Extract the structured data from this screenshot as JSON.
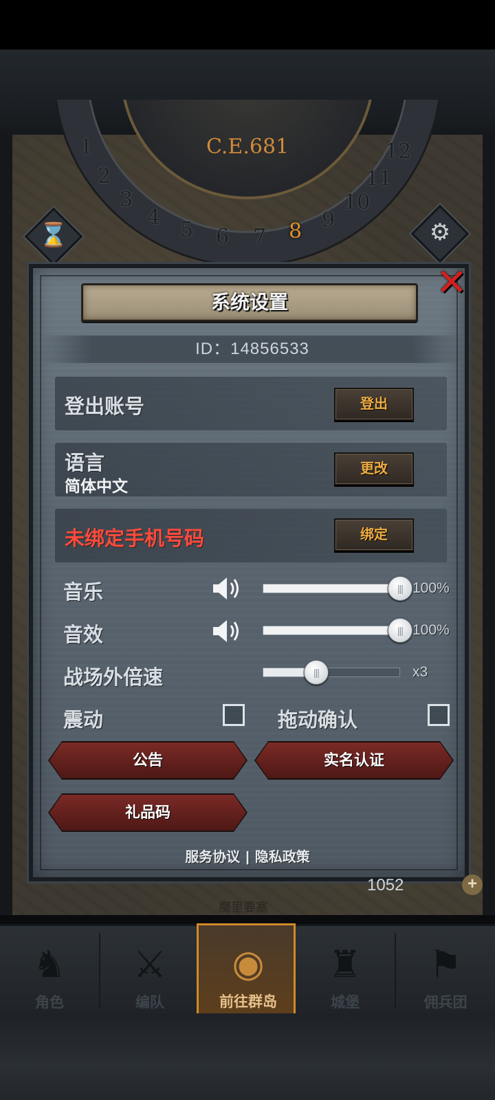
{
  "header": {
    "year": "C.E.681"
  },
  "dial": {
    "numbers": [
      "1",
      "2",
      "3",
      "4",
      "5",
      "6",
      "7",
      "8",
      "9",
      "10",
      "11",
      "12"
    ],
    "active": "8"
  },
  "settings": {
    "title": "系统设置",
    "id_text": "ID：14856533",
    "logout": {
      "label": "登出账号",
      "button": "登出"
    },
    "language": {
      "label": "语言",
      "value": "简体中文",
      "button": "更改"
    },
    "phone": {
      "label": "未绑定手机号码",
      "button": "绑定"
    },
    "music": {
      "label": "音乐",
      "value": 1.0,
      "percent": "100%"
    },
    "sfx": {
      "label": "音效",
      "value": 1.0,
      "percent": "100%"
    },
    "speed": {
      "label": "战场外倍速",
      "value": 0.39,
      "display": "x3"
    },
    "vibrate": {
      "label": "震动",
      "checked": false
    },
    "drag_confirm": {
      "label": "拖动确认",
      "checked": false
    },
    "announcement_button": "公告",
    "realname_button": "实名认证",
    "giftcode_button": "礼品码",
    "terms_link": "服务协议",
    "separator": "|",
    "privacy_link": "隐私政策"
  },
  "map": {
    "currency": "1052",
    "label": "魔里要塞"
  },
  "nav": {
    "items": [
      {
        "label": "角色",
        "icon": "knight-icon"
      },
      {
        "label": "编队",
        "icon": "squad-icon"
      },
      {
        "label": "前往群岛",
        "icon": "island-icon"
      },
      {
        "label": "城堡",
        "icon": "castle-icon"
      },
      {
        "label": "佣兵团",
        "icon": "mercenary-icon"
      }
    ],
    "active_index": 2
  },
  "colors": {
    "accent": "#f0ad42",
    "warning": "#ff4a3c",
    "close": "#d21f1f",
    "red_button": "#7a2a26"
  }
}
